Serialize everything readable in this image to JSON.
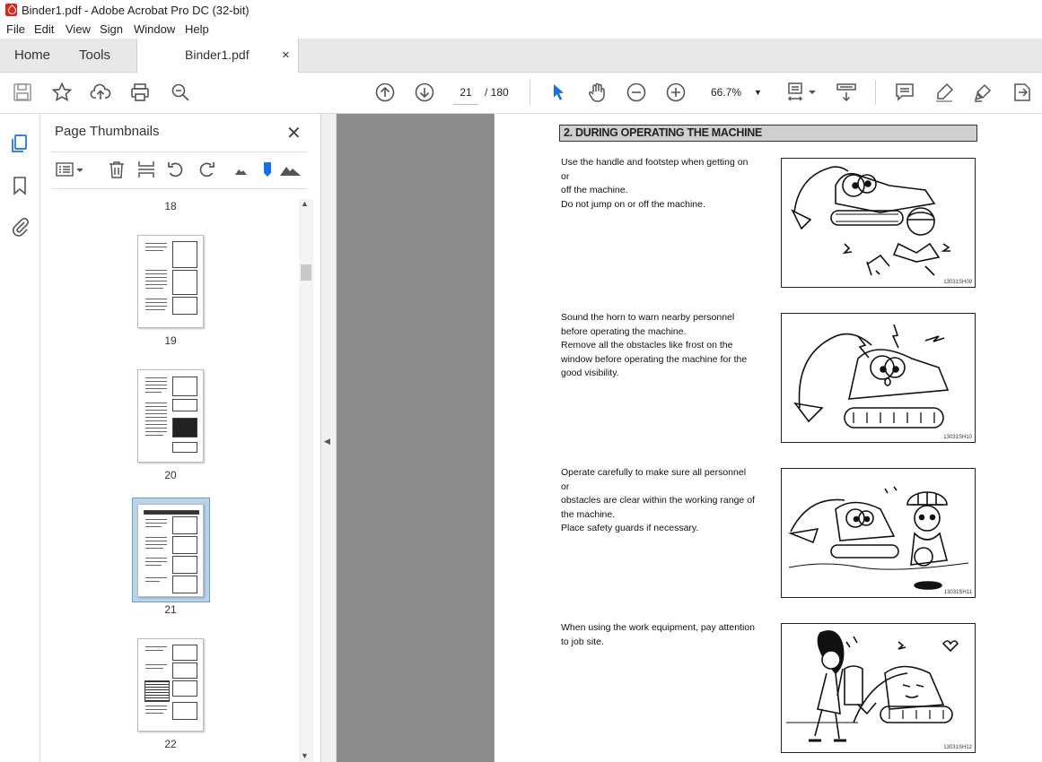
{
  "window": {
    "title": "Binder1.pdf - Adobe Acrobat Pro DC (32-bit)"
  },
  "menu": [
    "File",
    "Edit",
    "View",
    "Sign",
    "Window",
    "Help"
  ],
  "tabs": {
    "home": "Home",
    "tools": "Tools",
    "document": "Binder1.pdf",
    "close": "×"
  },
  "toolbar": {
    "current_page": "21",
    "total_pages": "/ 180",
    "zoom": "66.7%"
  },
  "panel": {
    "title": "Page Thumbnails",
    "close": "✕",
    "thumbs": [
      {
        "label": "18"
      },
      {
        "label": "19"
      },
      {
        "label": "20"
      },
      {
        "label": "21",
        "selected": true
      },
      {
        "label": "22"
      }
    ]
  },
  "document": {
    "heading": "2. DURING OPERATING THE MACHINE",
    "sections": [
      {
        "lines": [
          "Use the handle and footstep when getting on or",
          "off the machine.",
          "Do not jump on or off the machine."
        ],
        "figure_code": "13031SH09"
      },
      {
        "lines": [
          "Sound the horn to warn nearby personnel",
          "before operating the machine.",
          "Remove all the obstacles like frost on the",
          "window before operating the machine for the",
          "good visibility."
        ],
        "figure_code": "13031SH10"
      },
      {
        "lines": [
          "Operate carefully to make sure all personnel or",
          "obstacles are clear within the working range of",
          "the machine.",
          "Place safety guards if necessary."
        ],
        "figure_code": "13031SH11"
      },
      {
        "lines": [
          "When using the work equipment, pay attention",
          "to job site."
        ],
        "figure_code": "13031SH12"
      }
    ]
  },
  "colors": {
    "accent": "#1473e6",
    "canvas_bg": "#8c8c8c",
    "selection": "#b8d4ea"
  }
}
